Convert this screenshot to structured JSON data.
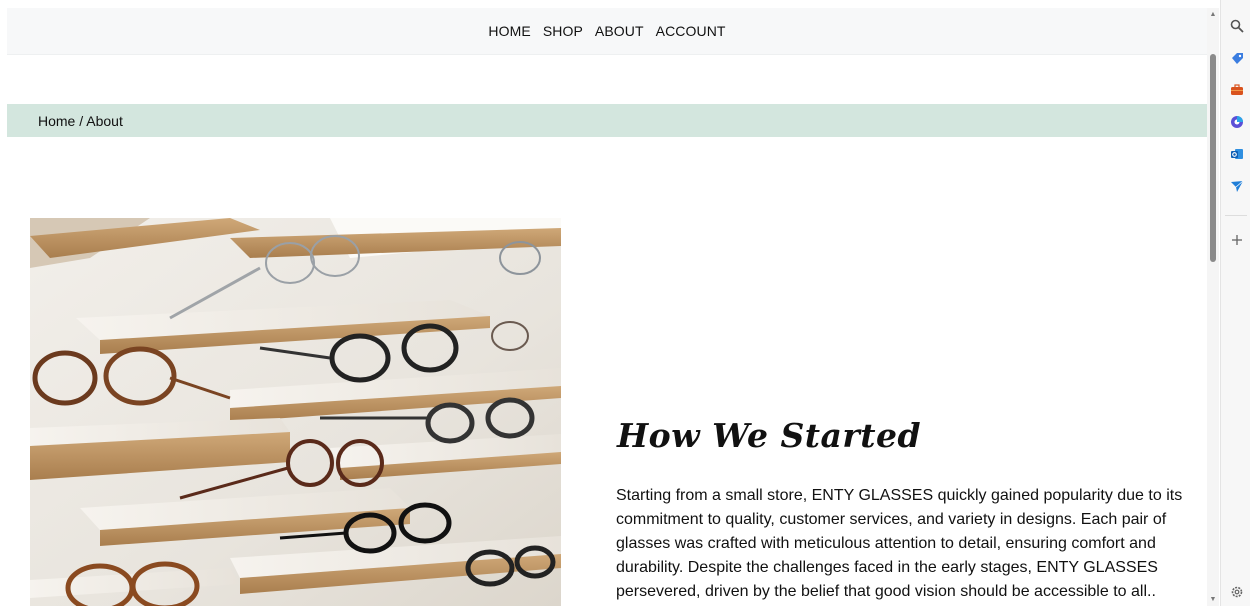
{
  "nav": {
    "items": [
      {
        "label": "HOME"
      },
      {
        "label": "SHOP"
      },
      {
        "label": "ABOUT"
      },
      {
        "label": "ACCOUNT"
      }
    ]
  },
  "breadcrumb": {
    "text": "Home / About"
  },
  "story": {
    "title": "How We Started",
    "body": "Starting from a small store, ENTY GLASSES quickly gained popularity due to its commitment to quality, customer services, and variety in designs. Each pair of glasses was crafted with meticulous attention to detail, ensuring comfort and durability. Despite the challenges faced in the early stages, ENTY GLASSES persevered, driven by the belief that good vision should be accessible to all.."
  },
  "hero_image": {
    "icon": "eyeglasses-display-shelves-photo"
  },
  "sidebar": {
    "icons": [
      "search-icon",
      "tag-icon",
      "briefcase-icon",
      "copilot-icon",
      "outlook-icon",
      "send-icon",
      "add-icon",
      "settings-icon"
    ]
  },
  "colors": {
    "breadcrumb_bg": "#d3e6de",
    "nav_bg": "#f7f8f9"
  }
}
